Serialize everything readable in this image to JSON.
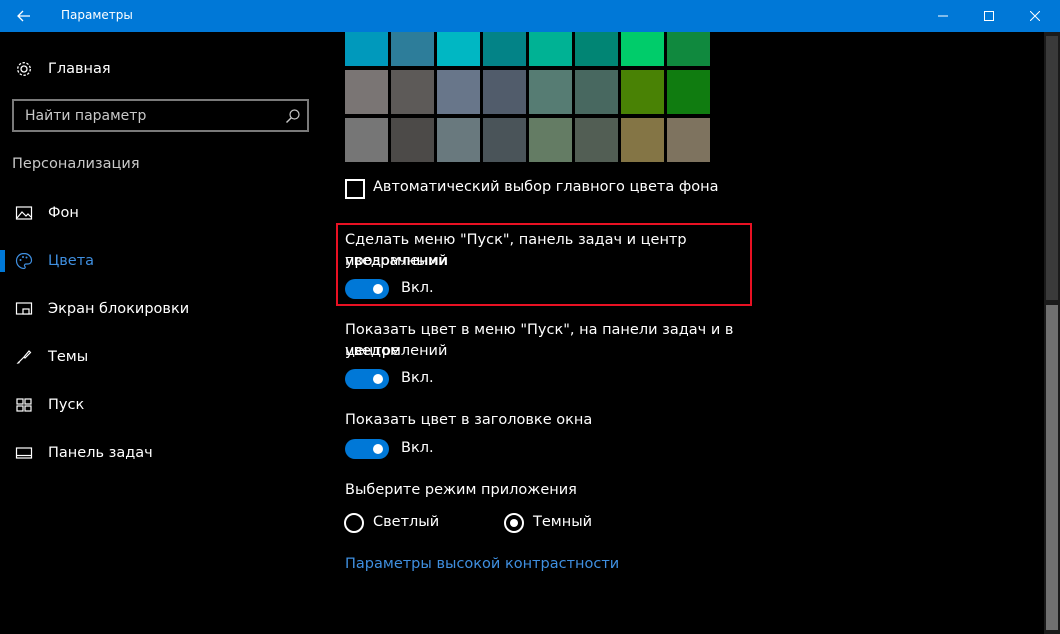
{
  "window": {
    "title": "Параметры",
    "accent_color": "#0078d7"
  },
  "sidebar": {
    "home_label": "Главная",
    "search_placeholder": "Найти параметр",
    "section_heading": "Персонализация",
    "items": [
      {
        "label": "Фон",
        "icon": "picture-icon"
      },
      {
        "label": "Цвета",
        "icon": "palette-icon",
        "active": true
      },
      {
        "label": "Экран блокировки",
        "icon": "lock-screen-icon"
      },
      {
        "label": "Темы",
        "icon": "themes-icon"
      },
      {
        "label": "Пуск",
        "icon": "start-icon"
      },
      {
        "label": "Панель задач",
        "icon": "taskbar-icon"
      }
    ]
  },
  "colors": {
    "swatches_row1": [
      "#0099bc",
      "#2d7d9a",
      "#00b7c3",
      "#038387",
      "#00b294",
      "#018574",
      "#00cc6a",
      "#10893e"
    ],
    "swatches_row2": [
      "#7a7574",
      "#5d5a58",
      "#68768a",
      "#515c6b",
      "#567c73",
      "#486860",
      "#498205",
      "#107c10"
    ],
    "swatches_row3": [
      "#767676",
      "#4c4a48",
      "#69797e",
      "#4a5459",
      "#647c64",
      "#525e54",
      "#847545",
      "#7e735f"
    ]
  },
  "auto_accent": {
    "label": "Автоматический выбор главного цвета фона",
    "checked": false
  },
  "transparency": {
    "title_line1": "Сделать меню \"Пуск\", панель задач и центр уведомлений",
    "title_line2": "прозрачными",
    "state": "Вкл."
  },
  "show_color_start": {
    "title_line1": "Показать цвет в меню \"Пуск\", на панели задач и в центре",
    "title_line2": "уведомлений",
    "state": "Вкл."
  },
  "show_color_title": {
    "title": "Показать цвет в заголовке окна",
    "state": "Вкл."
  },
  "app_mode": {
    "title": "Выберите режим приложения",
    "options": [
      "Светлый",
      "Темный"
    ],
    "selected": "Темный"
  },
  "high_contrast_link": "Параметры высокой контрастности"
}
